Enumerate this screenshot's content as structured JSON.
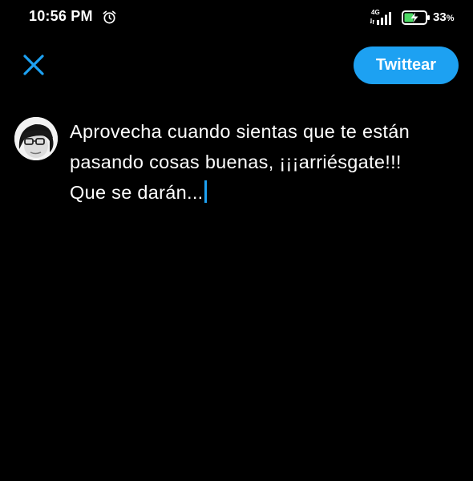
{
  "status_bar": {
    "time": "10:56 PM",
    "network_type": "4G",
    "battery_percent": "33",
    "battery_percent_sign": "%",
    "icons": [
      "alarm-icon",
      "signal-icon",
      "battery-charging-icon"
    ]
  },
  "header": {
    "close_icon": "close-icon",
    "tweet_button_label": "Twittear"
  },
  "composer": {
    "avatar": "profile-avatar",
    "lines": [
      "Aprovecha cuando sientas que te están",
      "pasando cosas buenas, ¡¡¡arriésgate!!!",
      "Que se darán..."
    ]
  },
  "colors": {
    "accent": "#1da1f2",
    "background": "#000000",
    "text": "#ffffff",
    "battery_charge": "#4cd964"
  }
}
